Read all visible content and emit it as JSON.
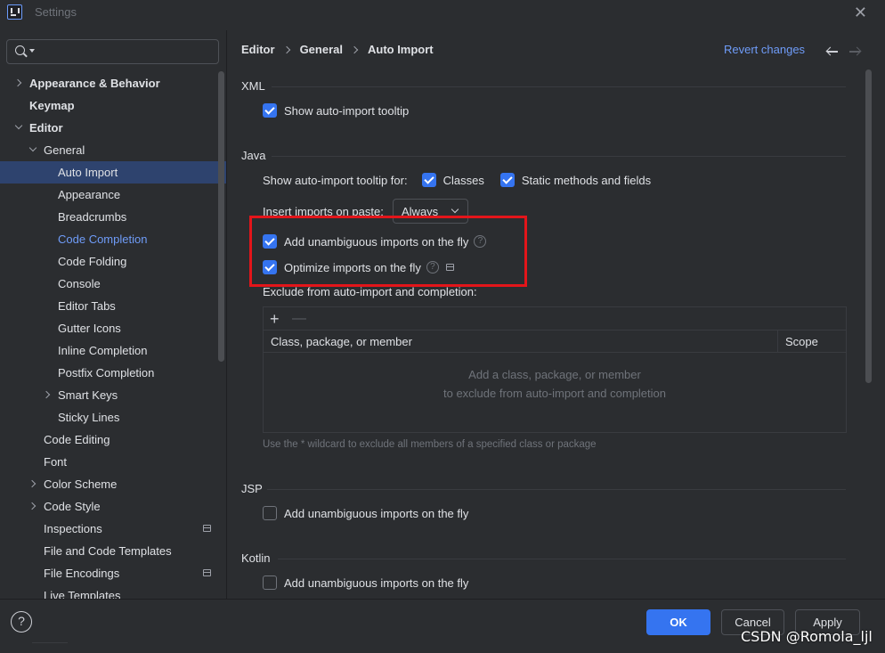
{
  "window": {
    "title": "Settings"
  },
  "search": {
    "placeholder": ""
  },
  "sidebar": {
    "items": [
      {
        "label": "Appearance & Behavior",
        "level": 0,
        "bold": true,
        "expander": "right"
      },
      {
        "label": "Keymap",
        "level": 0,
        "bold": true,
        "expander": ""
      },
      {
        "label": "Editor",
        "level": 0,
        "bold": true,
        "expander": "down"
      },
      {
        "label": "General",
        "level": 1,
        "expander": "down"
      },
      {
        "label": "Auto Import",
        "level": 2,
        "selected": true
      },
      {
        "label": "Appearance",
        "level": 2
      },
      {
        "label": "Breadcrumbs",
        "level": 2
      },
      {
        "label": "Code Completion",
        "level": 2,
        "link": true
      },
      {
        "label": "Code Folding",
        "level": 2
      },
      {
        "label": "Console",
        "level": 2
      },
      {
        "label": "Editor Tabs",
        "level": 2
      },
      {
        "label": "Gutter Icons",
        "level": 2
      },
      {
        "label": "Inline Completion",
        "level": 2
      },
      {
        "label": "Postfix Completion",
        "level": 2
      },
      {
        "label": "Smart Keys",
        "level": 2,
        "expander": "right"
      },
      {
        "label": "Sticky Lines",
        "level": 2
      },
      {
        "label": "Code Editing",
        "level": 1
      },
      {
        "label": "Font",
        "level": 1
      },
      {
        "label": "Color Scheme",
        "level": 1,
        "expander": "right"
      },
      {
        "label": "Code Style",
        "level": 1,
        "expander": "right"
      },
      {
        "label": "Inspections",
        "level": 1,
        "icon": "project-scope-icon"
      },
      {
        "label": "File and Code Templates",
        "level": 1
      },
      {
        "label": "File Encodings",
        "level": 1,
        "icon": "project-scope-icon"
      },
      {
        "label": "Live Templates",
        "level": 1
      }
    ]
  },
  "breadcrumb": {
    "part1": "Editor",
    "part2": "General",
    "part3": "Auto Import"
  },
  "header": {
    "revert_label": "Revert changes"
  },
  "xml": {
    "title": "XML",
    "show_tooltip_label": "Show auto-import tooltip",
    "show_tooltip_checked": true
  },
  "java": {
    "title": "Java",
    "tooltip_for_label": "Show auto-import tooltip for:",
    "classes_label": "Classes",
    "classes_checked": true,
    "static_label": "Static methods and fields",
    "static_checked": true,
    "paste_label": "Insert imports on paste:",
    "paste_value": "Always",
    "add_unambiguous_label": "Add unambiguous imports on the fly",
    "add_unambiguous_checked": true,
    "optimize_label": "Optimize imports on the fly",
    "optimize_checked": true,
    "exclude_label": "Exclude from auto-import and completion:",
    "table": {
      "col_class": "Class, package, or member",
      "col_scope": "Scope",
      "empty_line1": "Add a class, package, or member",
      "empty_line2": "to exclude from auto-import and completion"
    },
    "hint": "Use the * wildcard to exclude all members of a specified class or package"
  },
  "jsp": {
    "title": "JSP",
    "add_unambiguous_label": "Add unambiguous imports on the fly",
    "add_unambiguous_checked": false
  },
  "kotlin": {
    "title": "Kotlin",
    "add_unambiguous_label": "Add unambiguous imports on the fly",
    "add_unambiguous_checked": false
  },
  "footer": {
    "ok_label": "OK",
    "cancel_label": "Cancel",
    "apply_label": "Apply"
  },
  "watermark": "CSDN @Romola_ljl",
  "colors": {
    "accent": "#3574f0",
    "link": "#6f9cf8",
    "highlight_box": "#e3151a",
    "background": "#2b2d30",
    "selected_row": "#2e436e"
  }
}
